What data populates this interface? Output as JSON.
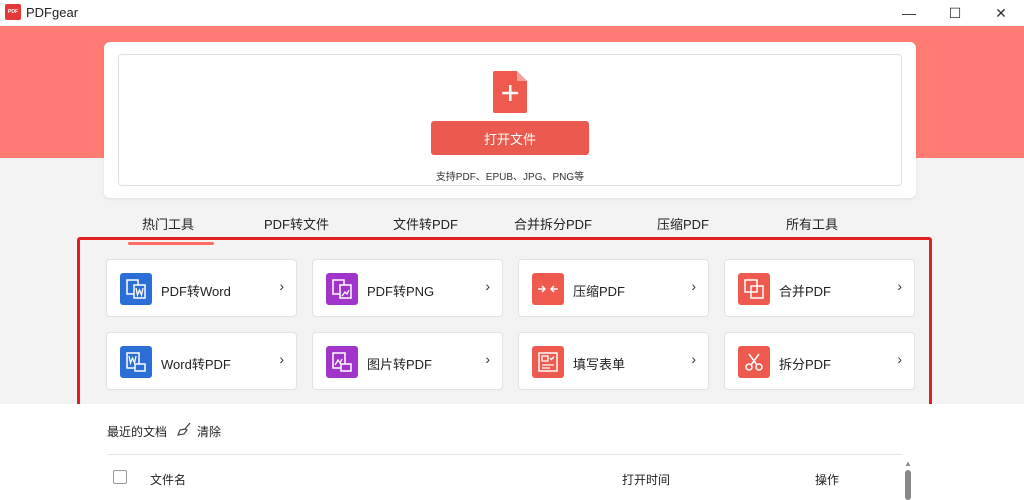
{
  "window": {
    "title": "PDFgear",
    "logo_text": "PDF"
  },
  "controls": {
    "minimize": "—",
    "maximize": "☐",
    "close": "✕"
  },
  "hero": {
    "open_button": "打开文件",
    "supported_formats": "支持PDF、EPUB、JPG、PNG等"
  },
  "tabs": [
    {
      "label": "热门工具",
      "selected": true
    },
    {
      "label": "PDF转文件"
    },
    {
      "label": "文件转PDF"
    },
    {
      "label": "合并拆分PDF"
    },
    {
      "label": "压缩PDF"
    },
    {
      "label": "所有工具"
    }
  ],
  "tools": [
    {
      "label": "PDF转Word",
      "icon": "pdf-to-word-icon",
      "color": "#2b6fd6"
    },
    {
      "label": "PDF转PNG",
      "icon": "pdf-to-png-icon",
      "color": "#a235c9"
    },
    {
      "label": "压缩PDF",
      "icon": "compress-icon",
      "color": "#ef5a4e"
    },
    {
      "label": "合并PDF",
      "icon": "merge-icon",
      "color": "#ef5a4e"
    },
    {
      "label": "Word转PDF",
      "icon": "word-to-pdf-icon",
      "color": "#2b6fd6"
    },
    {
      "label": "图片转PDF",
      "icon": "image-to-pdf-icon",
      "color": "#a235c9"
    },
    {
      "label": "填写表单",
      "icon": "fill-form-icon",
      "color": "#ef5a4e"
    },
    {
      "label": "拆分PDF",
      "icon": "split-icon",
      "color": "#ef5a4e"
    }
  ],
  "recent": {
    "title": "最近的文档",
    "clear_label": "清除",
    "columns": {
      "name": "文件名",
      "open_time": "打开时间",
      "actions": "操作"
    }
  },
  "colors": {
    "accent": "#ff7b73",
    "button": "#eb5a4f",
    "highlight": "#e02020"
  }
}
